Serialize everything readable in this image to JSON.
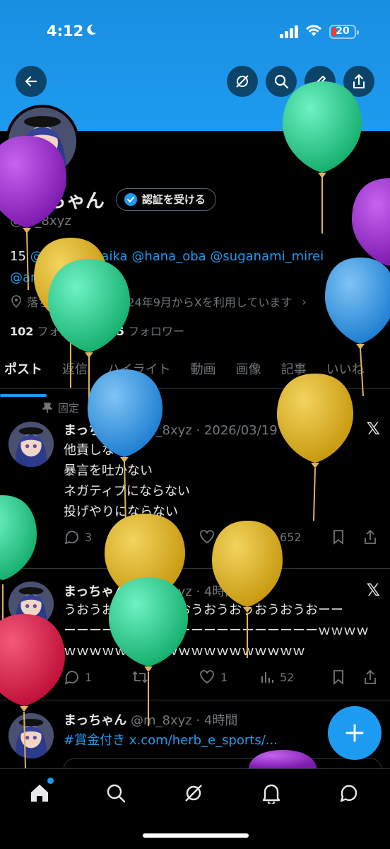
{
  "status_bar": {
    "time": "4:12",
    "battery": "20"
  },
  "profile": {
    "name": "まっちゃん",
    "verify_label": "認証を受ける",
    "handle": "@m_8xyz",
    "bio_prefix": "15 ",
    "bio_mentions": [
      "@sasaki_maika",
      "@hana_oba",
      "@suganami_mirei",
      "@amane_yuzuba"
    ],
    "location": "落ち込み中",
    "joined": "2024年9月からXを利用しています",
    "following_count": "102",
    "following_label": "フォロー中",
    "followers_count": "295",
    "followers_label": "フォロワー"
  },
  "tabs": [
    "ポスト",
    "返信",
    "ハイライト",
    "動画",
    "画像",
    "記事",
    "いいね"
  ],
  "pinned_label": "固定",
  "posts": [
    {
      "name": "まっちゃん",
      "meta": "@m_8xyz · 2026/03/19",
      "lines": [
        "他責しない",
        "暴言を吐かない",
        "ネガティブにならない",
        "投げやりにならない"
      ],
      "replies": "3",
      "reposts": "",
      "likes": "6",
      "views": "652"
    },
    {
      "name": "まっちゃん",
      "meta": "@m_8xyz · 4時間",
      "lines": [
        "うおうおうおうおうおうおうおうおうおうおーー",
        "ーーーーーーーーーーーーーーーーーーーーｗｗｗｗ",
        "ｗｗｗｗｗｗｗｗｗｗｗｗｗｗｗｗｗｗｗ"
      ],
      "replies": "1",
      "reposts": "",
      "likes": "1",
      "views": "52"
    },
    {
      "name": "まっちゃん",
      "meta": "@m_8xyz · 4時間",
      "hashtag": "#賞金付き",
      "link": "x.com/herb_e_sports/..."
    }
  ],
  "colors": {
    "accent": "#1d9bf0",
    "banner": "#1d9bf0",
    "background": "#000000",
    "muted": "#71767b"
  },
  "icons": {
    "back": "arrow-left-icon",
    "grok": "grok-icon",
    "search": "search-icon",
    "edit": "pencil-icon",
    "share": "share-icon",
    "nav": [
      "home-icon",
      "search-icon",
      "grok-icon",
      "bell-icon",
      "messages-icon"
    ]
  }
}
